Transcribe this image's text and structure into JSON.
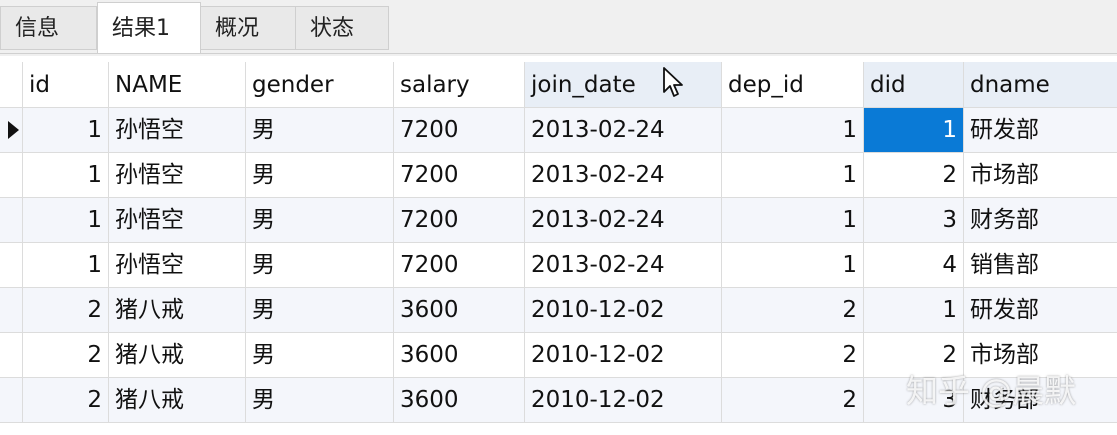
{
  "tabs": [
    {
      "label": "信息",
      "active": false
    },
    {
      "label": "结果1",
      "active": true
    },
    {
      "label": "概况",
      "active": false
    },
    {
      "label": "状态",
      "active": false
    }
  ],
  "table": {
    "columns": [
      "id",
      "NAME",
      "gender",
      "salary",
      "join_date",
      "dep_id",
      "did",
      "dname"
    ],
    "rows": [
      [
        "1",
        "孙悟空",
        "男",
        "7200",
        "2013-02-24",
        "1",
        "1",
        "研发部"
      ],
      [
        "1",
        "孙悟空",
        "男",
        "7200",
        "2013-02-24",
        "1",
        "2",
        "市场部"
      ],
      [
        "1",
        "孙悟空",
        "男",
        "7200",
        "2013-02-24",
        "1",
        "3",
        "财务部"
      ],
      [
        "1",
        "孙悟空",
        "男",
        "7200",
        "2013-02-24",
        "1",
        "4",
        "销售部"
      ],
      [
        "2",
        "猪八戒",
        "男",
        "3600",
        "2010-12-02",
        "2",
        "1",
        "研发部"
      ],
      [
        "2",
        "猪八戒",
        "男",
        "3600",
        "2010-12-02",
        "2",
        "2",
        "市场部"
      ],
      [
        "2",
        "猪八戒",
        "男",
        "3600",
        "2010-12-02",
        "2",
        "3",
        "财务部"
      ]
    ]
  },
  "colors": {
    "selection": "#0a7ad6",
    "column_highlight": "#e8eef6"
  },
  "icons": {
    "row_indicator": "current-row-arrow-icon",
    "cursor": "mouse-pointer-icon"
  },
  "watermark": "知乎 @晨默"
}
